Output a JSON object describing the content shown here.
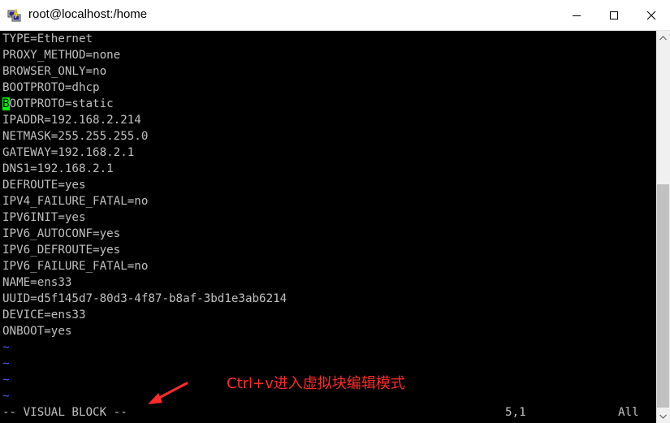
{
  "window": {
    "title": "root@localhost:/home",
    "icon": "putty-terminal-icon"
  },
  "terminal": {
    "lines": [
      "TYPE=Ethernet",
      "PROXY_METHOD=none",
      "BROWSER_ONLY=no",
      "BOOTPROTO=dhcp",
      "BOOTPROTO=static",
      "IPADDR=192.168.2.214",
      "NETMASK=255.255.255.0",
      "GATEWAY=192.168.2.1",
      "DNS1=192.168.2.1",
      "DEFROUTE=yes",
      "IPV4_FAILURE_FATAL=no",
      "IPV6INIT=yes",
      "IPV6_AUTOCONF=yes",
      "IPV6_DEFROUTE=yes",
      "IPV6_FAILURE_FATAL=no",
      "NAME=ens33",
      "UUID=d5f145d7-80d3-4f87-b8af-3bd1e3ab6214",
      "DEVICE=ens33",
      "ONBOOT=yes"
    ],
    "cursor_line": {
      "cursor_char": "B",
      "rest": "OOTPROTO=static"
    },
    "empty_marker": "~",
    "empty_lines": 4,
    "status": {
      "mode": "-- VISUAL BLOCK --",
      "position": "5,1",
      "scroll": "All"
    },
    "colors": {
      "background": "#000000",
      "text": "#c0c0c0",
      "cursor": "#00ff00",
      "tilde": "#5c5cff"
    }
  },
  "annotation": {
    "text": "Ctrl+v进入虚拟块编辑模式",
    "color": "#ff2a2a"
  }
}
